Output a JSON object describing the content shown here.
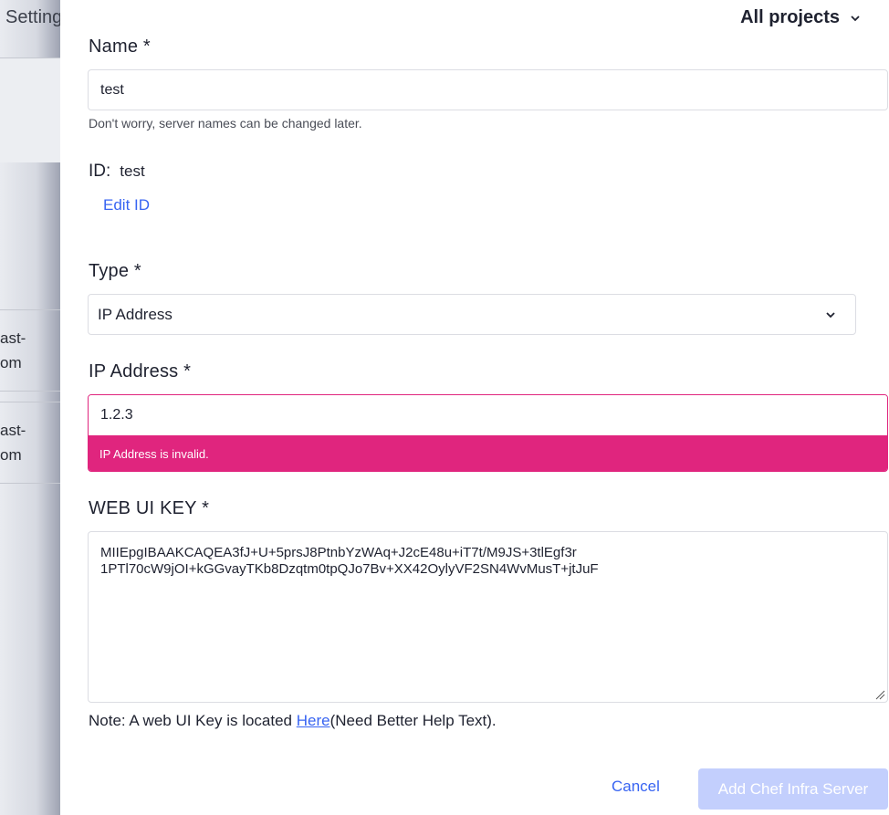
{
  "background": {
    "settings_label": "Setting",
    "row1_line1": "ast-",
    "row1_line2": "om",
    "row2_line1": "ast-",
    "row2_line2": "om"
  },
  "header": {
    "projects_label": "All projects"
  },
  "form": {
    "name": {
      "label": "Name *",
      "value": "test",
      "hint": "Don't worry, server names can be changed later."
    },
    "id": {
      "label": "ID:",
      "value": "test",
      "edit_link": "Edit ID"
    },
    "type": {
      "label": "Type *",
      "selected": "IP Address"
    },
    "ip_address": {
      "label": "IP Address *",
      "value": "1.2.3",
      "error": "IP Address is invalid."
    },
    "web_ui_key": {
      "label": "WEB UI KEY *",
      "line1": "MIIEpgIBAAKCAQEA3fJ+U+5prsJ8PtnbYzWAq+J2cE48u+iT7t/M9JS+3tlEgf3r",
      "line2": "1PTl70cW9jOI+kGGvayTKb8Dzqtm0tpQJo7Bv+XX42OylyVF2SN4WvMusT+jtJuF"
    },
    "note": {
      "prefix": "Note: A web UI Key is located ",
      "link": "Here",
      "suffix": "(Need Better Help Text)."
    }
  },
  "actions": {
    "cancel": "Cancel",
    "submit": "Add Chef Infra Server"
  },
  "colors": {
    "accent": "#3864f2",
    "error": "#e0257e",
    "submit_disabled": "#c3cffd"
  }
}
